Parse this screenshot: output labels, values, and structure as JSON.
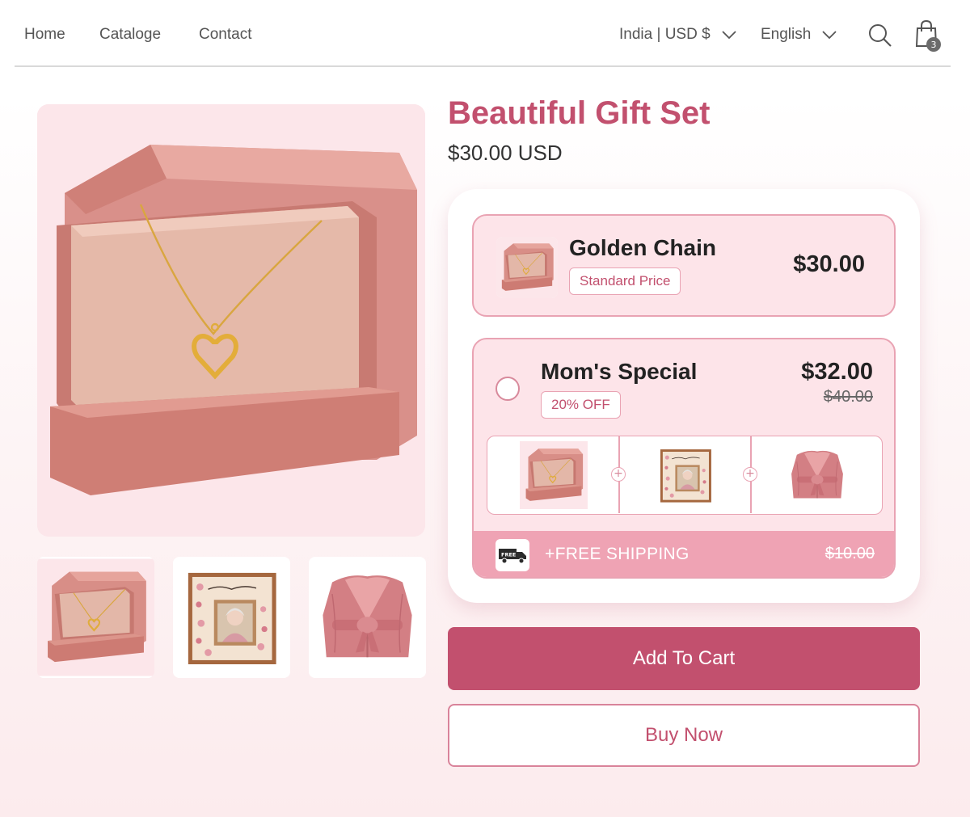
{
  "nav": {
    "links": [
      "Home",
      "Cataloge",
      "Contact"
    ],
    "region": "India | USD $",
    "language": "English",
    "cart_count": "3"
  },
  "product": {
    "title": "Beautiful Gift Set",
    "price": "$30.00 USD"
  },
  "bundle": {
    "offer1": {
      "name": "Golden Chain",
      "tag": "Standard Price",
      "price": "$30.00"
    },
    "offer2": {
      "name": "Mom's Special",
      "tag": "20% OFF",
      "price": "$32.00",
      "compare_price": "$40.00",
      "items": [
        "necklace-box",
        "love-you-mom-frame",
        "pink-robe"
      ],
      "shipping_label": "+FREE SHIPPING",
      "shipping_compare": "$10.00",
      "truck_badge": "FREE"
    }
  },
  "frame_text": "Love You Mom",
  "buttons": {
    "add_to_cart": "Add To Cart",
    "buy_now": "Buy Now"
  },
  "colors": {
    "accent": "#c2506e",
    "card_pink": "#fde4e9",
    "border_pink": "#e9a3b3",
    "shipping_bar": "#efa3b4"
  }
}
